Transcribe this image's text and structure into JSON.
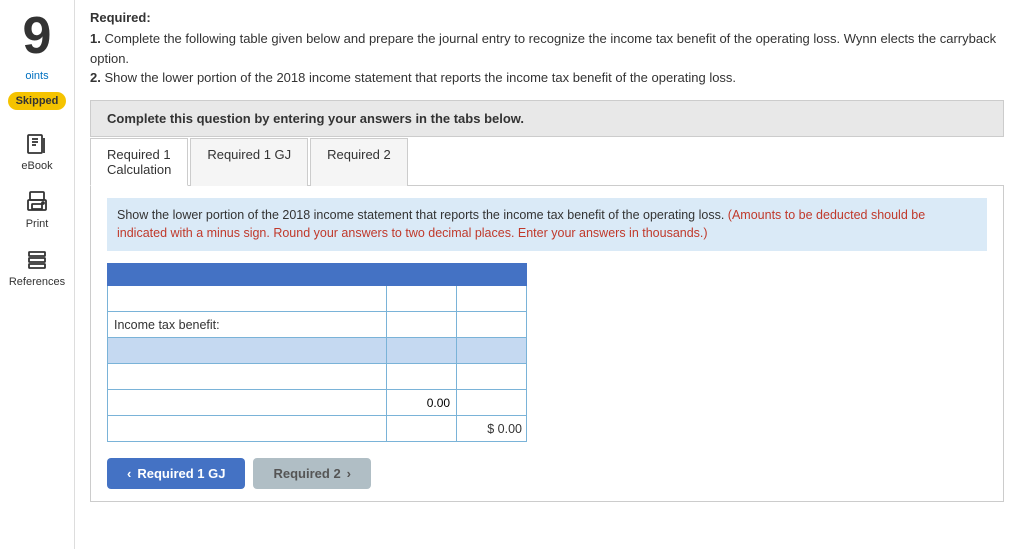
{
  "sidebar": {
    "question_number": "9",
    "points_label": "oints",
    "skipped_label": "Skipped",
    "icons": [
      {
        "name": "ebook",
        "label": "eBook",
        "icon": "book"
      },
      {
        "name": "print",
        "label": "Print",
        "icon": "print"
      },
      {
        "name": "references",
        "label": "References",
        "icon": "references"
      }
    ]
  },
  "header": {
    "required_label": "Required:",
    "instruction_1_num": "1.",
    "instruction_1_text": " Complete the following table given below and prepare the journal entry to recognize the income tax benefit of the operating loss. Wynn elects the carryback option.",
    "instruction_2_num": "2.",
    "instruction_2_text": " Show the lower portion of the 2018 income statement that reports the income tax benefit of the operating loss."
  },
  "info_bar": {
    "text": "Complete this question by entering your answers in the tabs below."
  },
  "tabs": [
    {
      "id": "req1calc",
      "label": "Required 1\nCalculation",
      "active": true
    },
    {
      "id": "req1gj",
      "label": "Required 1 GJ",
      "active": false
    },
    {
      "id": "req2",
      "label": "Required 2",
      "active": false
    }
  ],
  "content": {
    "instruction": "Show the lower portion of the 2018 income statement that reports the income tax benefit of the operating loss.",
    "instruction_red": "(Amounts to be deducted should be indicated with a minus sign. Round your answers to two decimal places. Enter your answers in thousands.)",
    "table": {
      "rows": [
        {
          "type": "header",
          "label": "",
          "value": "",
          "dollar": ""
        },
        {
          "type": "data",
          "label": "",
          "value": "",
          "dollar": ""
        },
        {
          "type": "data",
          "label": "Income tax benefit:",
          "value": "",
          "dollar": ""
        },
        {
          "type": "blue",
          "label": "",
          "value": "",
          "dollar": ""
        },
        {
          "type": "data",
          "label": "",
          "value": "",
          "dollar": ""
        },
        {
          "type": "data",
          "label": "",
          "value": "0.00",
          "dollar": ""
        },
        {
          "type": "data",
          "label": "",
          "value": "",
          "dollar": "$ 0.00"
        }
      ]
    }
  },
  "nav_buttons": {
    "back_label": "Required 1 GJ",
    "forward_label": "Required 2"
  }
}
